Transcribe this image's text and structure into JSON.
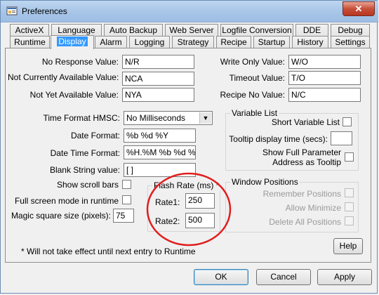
{
  "window": {
    "title": "Preferences",
    "close": "✕"
  },
  "tabs_row1": [
    "ActiveX",
    "Language",
    "Auto Backup",
    "Web Server",
    "Logfile Conversion",
    "DDE",
    "Debug"
  ],
  "tabs_row2": [
    "Runtime",
    "Display",
    "Alarm",
    "Logging",
    "Strategy",
    "Recipe",
    "Startup",
    "History",
    "Settings"
  ],
  "active_tab": "Display",
  "fields": {
    "no_response": {
      "label": "No Response Value:",
      "value": "N/R"
    },
    "not_available": {
      "label": "Not Currently Available Value:",
      "value": "NCA"
    },
    "not_yet": {
      "label": "Not Yet Available Value:",
      "value": "NYA"
    },
    "write_only": {
      "label": "Write Only Value:",
      "value": "W/O"
    },
    "timeout": {
      "label": "Timeout Value:",
      "value": "T/O"
    },
    "recipe_no": {
      "label": "Recipe No Value:",
      "value": "N/C"
    },
    "time_format": {
      "label": "Time Format HMSC:",
      "value": "No Milliseconds"
    },
    "date_format": {
      "label": "Date Format:",
      "value": "%b %d %Y"
    },
    "date_time_format": {
      "label": "Date Time Format:",
      "value": "%H.%M %b %d %Y"
    },
    "blank_string": {
      "label": "Blank String value:",
      "value": "[  ]"
    },
    "show_scroll": {
      "label": "Show scroll bars"
    },
    "full_screen": {
      "label": "Full screen mode in runtime"
    },
    "magic_square": {
      "label": "Magic square size (pixels):",
      "value": "75"
    }
  },
  "variable_list": {
    "title": "Variable List",
    "short": "Short Variable List",
    "tooltip_time": "Tooltip display time (secs):",
    "tooltip_value": "",
    "full_param_1": "Show Full Parameter",
    "full_param_2": "Address as Tooltip"
  },
  "flash_rate": {
    "title": "Flash Rate (ms) *",
    "rate1_label": "Rate1:",
    "rate1": "250",
    "rate2_label": "Rate2:",
    "rate2": "500"
  },
  "window_positions": {
    "title": "Window Positions",
    "remember": "Remember Positions",
    "allow_min": "Allow Minimize",
    "delete_all": "Delete All Positions"
  },
  "note": "* Will not take effect until next entry to Runtime",
  "buttons": {
    "help": "Help",
    "ok": "OK",
    "cancel": "Cancel",
    "apply": "Apply"
  },
  "colors": {
    "selected_tab": "#3399ff",
    "highlight_circle": "#e11d1d"
  }
}
